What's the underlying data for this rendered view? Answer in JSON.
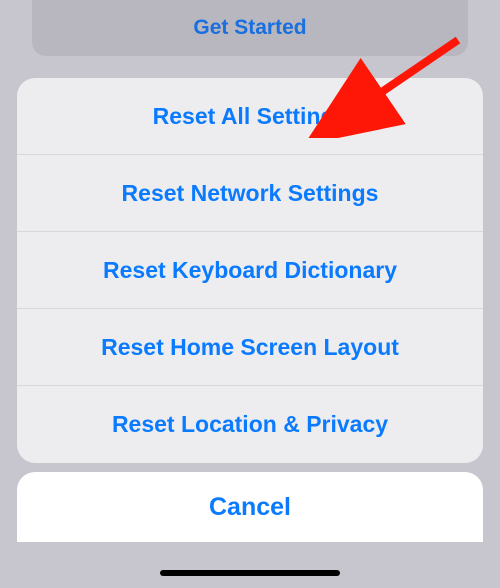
{
  "background_button": {
    "label": "Get Started"
  },
  "sheet": {
    "items": [
      {
        "label": "Reset All Settings"
      },
      {
        "label": "Reset Network Settings"
      },
      {
        "label": "Reset Keyboard Dictionary"
      },
      {
        "label": "Reset Home Screen Layout"
      },
      {
        "label": "Reset Location & Privacy"
      }
    ]
  },
  "cancel": {
    "label": "Cancel"
  },
  "colors": {
    "accent": "#0a7aff",
    "annotation": "#fe1607"
  }
}
